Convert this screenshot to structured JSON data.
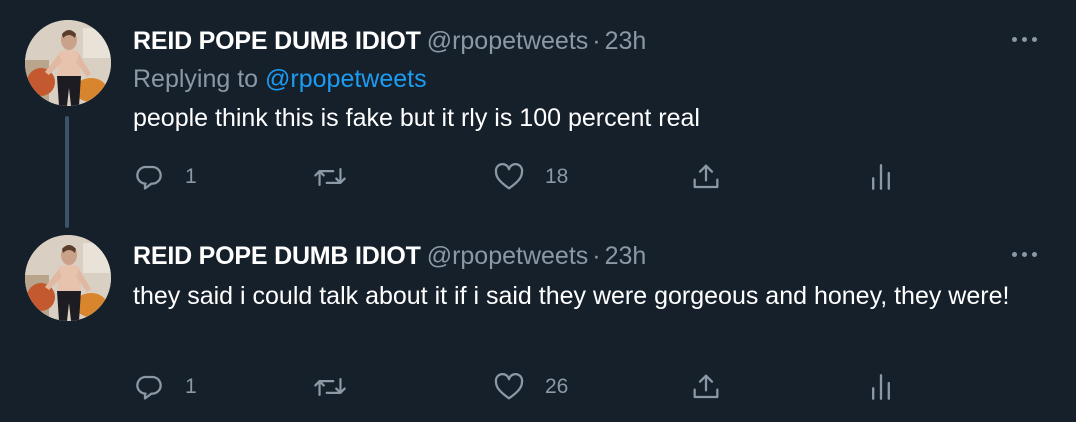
{
  "tweets": [
    {
      "display_name": "REID POPE DUMB IDIOT",
      "handle": "@rpopetweets",
      "separator": "·",
      "time": "23h",
      "replying_prefix": "Replying to",
      "replying_to": "@rpopetweets",
      "text": "people think this is fake but it rly is 100 percent real",
      "reply_count": "1",
      "like_count": "18"
    },
    {
      "display_name": "REID POPE DUMB IDIOT",
      "handle": "@rpopetweets",
      "separator": "·",
      "time": "23h",
      "text": "they said i could talk about it if i said they were gorgeous and honey, they were!",
      "reply_count": "1",
      "like_count": "26"
    }
  ],
  "icons": {
    "reply": "reply-icon",
    "retweet": "retweet-icon",
    "like": "heart-icon",
    "share": "share-icon",
    "analytics": "analytics-icon",
    "more": "more-icon"
  },
  "colors": {
    "background": "#15202b",
    "text_primary": "#ffffff",
    "text_secondary": "#8b98a5",
    "accent": "#1d9bf0",
    "thread_line": "#3d5466"
  }
}
